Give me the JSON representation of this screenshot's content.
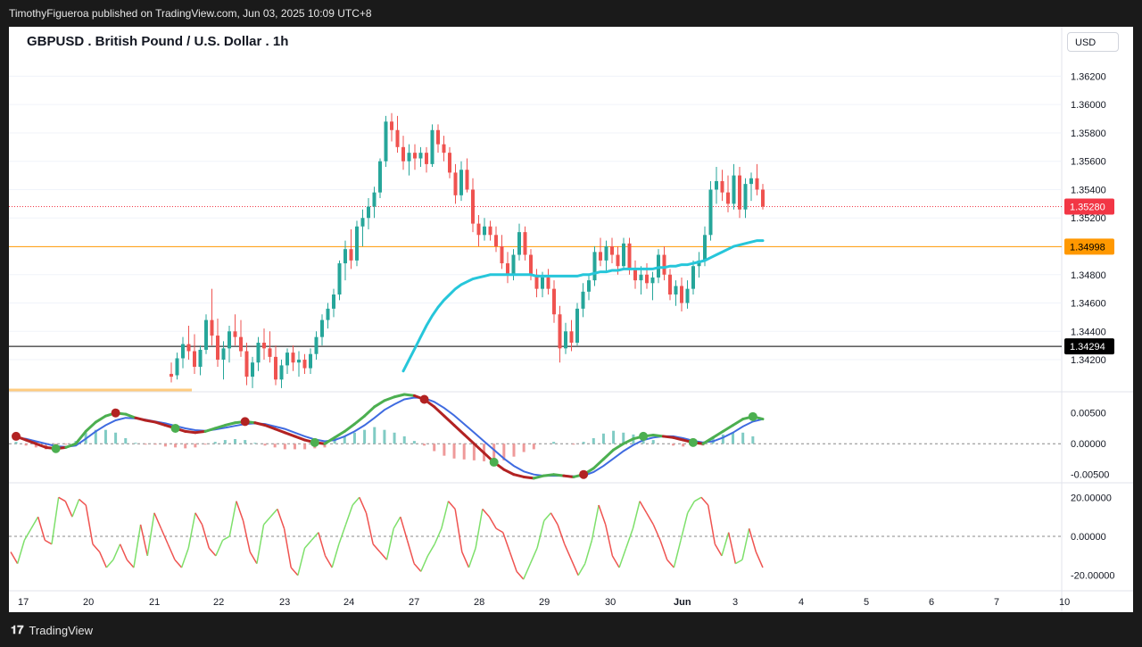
{
  "header": {
    "publisher_line": "TimothyFigueroa published on TradingView.com, Jun 03, 2025 10:09 UTC+8"
  },
  "footer": {
    "brand": "TradingView",
    "logo_icon": "tradingview-logo-icon"
  },
  "chart_data": {
    "type": "candlestick",
    "title": "GBPUSD . British Pound / U.S. Dollar . 1h",
    "currency_label": "USD",
    "price_axis": {
      "range": [
        1.3398,
        1.3636
      ],
      "ticks": [
        "1.36200",
        "1.36000",
        "1.35800",
        "1.35600",
        "1.35400",
        "1.35200",
        "1.34800",
        "1.34600",
        "1.34400",
        "1.34200"
      ],
      "tick_values": [
        1.362,
        1.36,
        1.358,
        1.356,
        1.354,
        1.352,
        1.348,
        1.346,
        1.344,
        1.342
      ]
    },
    "time_axis": {
      "labels": [
        "17",
        "20",
        "21",
        "22",
        "23",
        "24",
        "27",
        "28",
        "29",
        "30",
        "Jun",
        "3",
        "4",
        "5",
        "6",
        "7",
        "10"
      ]
    },
    "price_labels": {
      "last": {
        "text": "1.35280",
        "value": 1.3528,
        "color": "#f23645"
      },
      "resistance": {
        "text": "1.34998",
        "value": 1.34998,
        "color": "#ff9800"
      },
      "support": {
        "text": "1.34294",
        "value": 1.34294,
        "color": "#000000"
      }
    },
    "candles": [
      [
        1.341,
        1.3418,
        1.3404,
        1.3408
      ],
      [
        1.3409,
        1.3425,
        1.3406,
        1.3421
      ],
      [
        1.3421,
        1.3436,
        1.3414,
        1.3431
      ],
      [
        1.3431,
        1.3444,
        1.342,
        1.3426
      ],
      [
        1.3426,
        1.3438,
        1.341,
        1.3415
      ],
      [
        1.3415,
        1.343,
        1.3409,
        1.3427
      ],
      [
        1.3427,
        1.3452,
        1.3424,
        1.3448
      ],
      [
        1.3448,
        1.347,
        1.343,
        1.3437
      ],
      [
        1.3437,
        1.3449,
        1.3415,
        1.342
      ],
      [
        1.342,
        1.3433,
        1.3406,
        1.3428
      ],
      [
        1.3428,
        1.3444,
        1.3418,
        1.344
      ],
      [
        1.344,
        1.3452,
        1.343,
        1.3436
      ],
      [
        1.3436,
        1.3448,
        1.3422,
        1.3426
      ],
      [
        1.3426,
        1.3432,
        1.3402,
        1.3408
      ],
      [
        1.3408,
        1.3422,
        1.34,
        1.3418
      ],
      [
        1.3418,
        1.3436,
        1.3412,
        1.3432
      ],
      [
        1.3432,
        1.3442,
        1.342,
        1.3428
      ],
      [
        1.3428,
        1.344,
        1.3418,
        1.3422
      ],
      [
        1.3422,
        1.343,
        1.3402,
        1.3406
      ],
      [
        1.3406,
        1.342,
        1.34,
        1.3416
      ],
      [
        1.3416,
        1.3428,
        1.341,
        1.3425
      ],
      [
        1.3425,
        1.343,
        1.3412,
        1.3418
      ],
      [
        1.3418,
        1.3426,
        1.3408,
        1.342
      ],
      [
        1.342,
        1.3424,
        1.341,
        1.3414
      ],
      [
        1.3414,
        1.3428,
        1.341,
        1.3424
      ],
      [
        1.3424,
        1.344,
        1.342,
        1.3436
      ],
      [
        1.3436,
        1.3452,
        1.343,
        1.3448
      ],
      [
        1.3448,
        1.346,
        1.3442,
        1.3456
      ],
      [
        1.3456,
        1.347,
        1.345,
        1.3466
      ],
      [
        1.3466,
        1.349,
        1.3462,
        1.3488
      ],
      [
        1.3488,
        1.3504,
        1.3476,
        1.3498
      ],
      [
        1.3498,
        1.3512,
        1.3484,
        1.349
      ],
      [
        1.349,
        1.3518,
        1.3486,
        1.3514
      ],
      [
        1.3514,
        1.3526,
        1.35,
        1.352
      ],
      [
        1.352,
        1.3534,
        1.3512,
        1.3528
      ],
      [
        1.3528,
        1.3542,
        1.352,
        1.3538
      ],
      [
        1.3538,
        1.3562,
        1.3534,
        1.356
      ],
      [
        1.356,
        1.3592,
        1.3556,
        1.3588
      ],
      [
        1.3588,
        1.3594,
        1.3574,
        1.3582
      ],
      [
        1.3582,
        1.3592,
        1.3566,
        1.357
      ],
      [
        1.357,
        1.3578,
        1.3554,
        1.356
      ],
      [
        1.356,
        1.3572,
        1.355,
        1.3566
      ],
      [
        1.3566,
        1.3572,
        1.3554,
        1.3562
      ],
      [
        1.3562,
        1.357,
        1.3556,
        1.3566
      ],
      [
        1.3566,
        1.357,
        1.3552,
        1.3558
      ],
      [
        1.3558,
        1.3586,
        1.3556,
        1.3582
      ],
      [
        1.3582,
        1.3586,
        1.3566,
        1.3572
      ],
      [
        1.3572,
        1.3578,
        1.356,
        1.3566
      ],
      [
        1.3566,
        1.357,
        1.3548,
        1.3552
      ],
      [
        1.3552,
        1.3558,
        1.353,
        1.3536
      ],
      [
        1.3536,
        1.356,
        1.3532,
        1.3554
      ],
      [
        1.3554,
        1.3562,
        1.3538,
        1.354
      ],
      [
        1.354,
        1.3548,
        1.351,
        1.3516
      ],
      [
        1.3516,
        1.3522,
        1.35,
        1.3508
      ],
      [
        1.3508,
        1.352,
        1.3504,
        1.3514
      ],
      [
        1.3514,
        1.3518,
        1.3504,
        1.3508
      ],
      [
        1.3508,
        1.3514,
        1.3496,
        1.35
      ],
      [
        1.35,
        1.3508,
        1.3484,
        1.3488
      ],
      [
        1.3488,
        1.3496,
        1.3474,
        1.348
      ],
      [
        1.348,
        1.3498,
        1.3476,
        1.3494
      ],
      [
        1.3494,
        1.3516,
        1.349,
        1.351
      ],
      [
        1.351,
        1.3514,
        1.349,
        1.3494
      ],
      [
        1.3494,
        1.3498,
        1.3476,
        1.348
      ],
      [
        1.348,
        1.3484,
        1.3464,
        1.347
      ],
      [
        1.347,
        1.3482,
        1.3464,
        1.3478
      ],
      [
        1.3478,
        1.3484,
        1.3466,
        1.347
      ],
      [
        1.347,
        1.3476,
        1.3446,
        1.3452
      ],
      [
        1.3452,
        1.3458,
        1.3418,
        1.3428
      ],
      [
        1.3428,
        1.3446,
        1.3424,
        1.344
      ],
      [
        1.344,
        1.3448,
        1.3426,
        1.3432
      ],
      [
        1.3432,
        1.346,
        1.343,
        1.3456
      ],
      [
        1.3456,
        1.3474,
        1.345,
        1.3468
      ],
      [
        1.3468,
        1.348,
        1.3462,
        1.3476
      ],
      [
        1.3476,
        1.35,
        1.3472,
        1.3496
      ],
      [
        1.3496,
        1.3506,
        1.3486,
        1.349
      ],
      [
        1.349,
        1.3504,
        1.3482,
        1.35
      ],
      [
        1.35,
        1.3506,
        1.3488,
        1.3494
      ],
      [
        1.3494,
        1.35,
        1.348,
        1.3486
      ],
      [
        1.3486,
        1.3506,
        1.3484,
        1.3502
      ],
      [
        1.3502,
        1.3506,
        1.348,
        1.3484
      ],
      [
        1.3484,
        1.349,
        1.347,
        1.3476
      ],
      [
        1.3476,
        1.3486,
        1.3466,
        1.348
      ],
      [
        1.348,
        1.3488,
        1.347,
        1.3474
      ],
      [
        1.3474,
        1.3482,
        1.3462,
        1.3478
      ],
      [
        1.3478,
        1.3498,
        1.3474,
        1.3494
      ],
      [
        1.3494,
        1.35,
        1.3476,
        1.348
      ],
      [
        1.348,
        1.3484,
        1.3462,
        1.3466
      ],
      [
        1.3466,
        1.3476,
        1.3458,
        1.3472
      ],
      [
        1.3472,
        1.3478,
        1.3454,
        1.346
      ],
      [
        1.346,
        1.3476,
        1.3456,
        1.347
      ],
      [
        1.347,
        1.349,
        1.3466,
        1.3486
      ],
      [
        1.3486,
        1.3496,
        1.3478,
        1.349
      ],
      [
        1.349,
        1.3514,
        1.3486,
        1.3508
      ],
      [
        1.3508,
        1.3546,
        1.3504,
        1.354
      ],
      [
        1.354,
        1.3556,
        1.353,
        1.3546
      ],
      [
        1.3546,
        1.3554,
        1.3532,
        1.3538
      ],
      [
        1.3538,
        1.355,
        1.3524,
        1.353
      ],
      [
        1.353,
        1.3558,
        1.3526,
        1.355
      ],
      [
        1.355,
        1.3556,
        1.352,
        1.3526
      ],
      [
        1.3526,
        1.3548,
        1.352,
        1.3544
      ],
      [
        1.3544,
        1.3552,
        1.3532,
        1.3548
      ],
      [
        1.3548,
        1.3558,
        1.3536,
        1.354
      ],
      [
        1.354,
        1.3544,
        1.3526,
        1.3528
      ]
    ],
    "series": [
      {
        "name": "MA",
        "color": "#26c6da",
        "values": [
          null,
          null,
          null,
          null,
          null,
          null,
          null,
          null,
          null,
          null,
          null,
          null,
          null,
          null,
          null,
          null,
          null,
          null,
          null,
          null,
          null,
          null,
          null,
          null,
          null,
          null,
          null,
          null,
          null,
          null,
          null,
          null,
          null,
          null,
          null,
          null,
          null,
          null,
          null,
          null,
          1.3412,
          1.342,
          1.3428,
          1.3436,
          1.3444,
          1.3451,
          1.3457,
          1.3462,
          1.3466,
          1.347,
          1.3473,
          1.3475,
          1.3477,
          1.3478,
          1.3479,
          1.348,
          1.348,
          1.348,
          1.348,
          1.348,
          1.348,
          1.348,
          1.348,
          1.3479,
          1.3479,
          1.3479,
          1.3479,
          1.3479,
          1.3479,
          1.3479,
          1.3479,
          1.348,
          1.348,
          1.3481,
          1.3482,
          1.3482,
          1.3483,
          1.3483,
          1.3484,
          1.3484,
          1.3484,
          1.3484,
          1.3484,
          1.3484,
          1.3485,
          1.3485,
          1.3486,
          1.3486,
          1.3487,
          1.3487,
          1.3488,
          1.3489,
          1.349,
          1.3492,
          1.3494,
          1.3496,
          1.3498,
          1.35,
          1.3501,
          1.3502,
          1.3503,
          1.3504,
          1.3504
        ]
      }
    ],
    "macd": {
      "ticks": [
        "0.00500",
        "0.00000",
        "-0.00500"
      ],
      "tick_values": [
        0.005,
        0,
        -0.005
      ],
      "range": [
        -0.0062,
        0.008
      ],
      "macd_line": [
        0.0012,
        0.0006,
        0.0,
        -0.0006,
        -0.0008,
        -0.0006,
        0.0,
        0.002,
        0.0035,
        0.0045,
        0.005,
        0.0048,
        0.0042,
        0.0038,
        0.0035,
        0.003,
        0.0025,
        0.002,
        0.0018,
        0.002,
        0.0025,
        0.003,
        0.0034,
        0.0036,
        0.0034,
        0.003,
        0.0024,
        0.0018,
        0.0012,
        0.0006,
        0.0002,
        0.0,
        0.001,
        0.002,
        0.0032,
        0.0045,
        0.006,
        0.007,
        0.0076,
        0.008,
        0.0078,
        0.0072,
        0.006,
        0.0045,
        0.003,
        0.0015,
        0.0,
        -0.0015,
        -0.003,
        -0.0042,
        -0.005,
        -0.0054,
        -0.0056,
        -0.0052,
        -0.005,
        -0.0052,
        -0.0054,
        -0.005,
        -0.004,
        -0.0025,
        -0.001,
        0.0,
        0.0008,
        0.0012,
        0.0014,
        0.0012,
        0.001,
        0.0006,
        0.0002,
        0.0,
        0.001,
        0.002,
        0.003,
        0.004,
        0.0044,
        0.004
      ],
      "signal_line": [
        0.001,
        0.0008,
        0.0004,
        0.0,
        -0.0004,
        -0.0005,
        -0.0003,
        0.0008,
        0.002,
        0.003,
        0.0038,
        0.0042,
        0.0041,
        0.0039,
        0.0036,
        0.0033,
        0.0029,
        0.0025,
        0.0022,
        0.0021,
        0.0023,
        0.0026,
        0.0029,
        0.0032,
        0.0033,
        0.0032,
        0.0028,
        0.0024,
        0.0018,
        0.0012,
        0.0007,
        0.0004,
        0.0006,
        0.0012,
        0.002,
        0.003,
        0.0042,
        0.0055,
        0.0064,
        0.0072,
        0.0075,
        0.0074,
        0.0068,
        0.0058,
        0.0046,
        0.0032,
        0.0018,
        0.0004,
        -0.001,
        -0.0024,
        -0.0036,
        -0.0045,
        -0.005,
        -0.0052,
        -0.0052,
        -0.0052,
        -0.0053,
        -0.0052,
        -0.0046,
        -0.0036,
        -0.0024,
        -0.0012,
        -0.0002,
        0.0006,
        0.001,
        0.0012,
        0.0012,
        0.0009,
        0.0005,
        0.0002,
        0.0004,
        0.001,
        0.0018,
        0.0028,
        0.0036,
        0.004
      ],
      "cross_markers": [
        [
          0,
          "bearish"
        ],
        [
          6,
          "bullish"
        ],
        [
          14,
          "bearish"
        ],
        [
          24,
          "bullish"
        ],
        [
          33,
          "bearish"
        ],
        [
          44,
          "bullish"
        ],
        [
          60,
          "bearish"
        ],
        [
          71,
          "bullish"
        ],
        [
          84,
          "bearish"
        ],
        [
          93,
          "bullish"
        ],
        [
          99,
          "bullish"
        ],
        [
          109,
          "bullish"
        ]
      ]
    },
    "oscillator": {
      "ticks": [
        "20.00000",
        "0.00000",
        "-20.00000"
      ],
      "tick_values": [
        20,
        0,
        -20
      ],
      "range": [
        -27,
        27
      ],
      "values": [
        -8,
        -14,
        -2,
        4,
        10,
        -2,
        -4,
        20,
        18,
        10,
        19,
        16,
        -4,
        -8,
        -16,
        -12,
        -4,
        -12,
        -16,
        6,
        -10,
        12,
        4,
        -4,
        -12,
        -16,
        -6,
        12,
        6,
        -6,
        -10,
        -2,
        0,
        18,
        8,
        -8,
        -14,
        6,
        10,
        14,
        4,
        -16,
        -20,
        -6,
        -2,
        2,
        -10,
        -16,
        -4,
        6,
        16,
        20,
        12,
        -4,
        -8,
        -12,
        4,
        10,
        -2,
        -14,
        -18,
        -10,
        -4,
        4,
        18,
        14,
        -8,
        -16,
        -6,
        14,
        10,
        4,
        2,
        -8,
        -18,
        -22,
        -14,
        -6,
        8,
        12,
        6,
        -4,
        -12,
        -20,
        -14,
        -2,
        16,
        6,
        -10,
        -16,
        -6,
        4,
        18,
        12,
        6,
        -2,
        -12,
        -16,
        -2,
        12,
        18,
        20,
        16,
        -4,
        -10,
        2,
        -14,
        -12,
        4,
        -8,
        -16
      ]
    },
    "grid": true,
    "colors": {
      "up": "#26a69a",
      "down": "#ef5350",
      "macd_bull": "#4caf50",
      "macd_bear": "#b22222",
      "signal": "#3f6be0"
    }
  }
}
